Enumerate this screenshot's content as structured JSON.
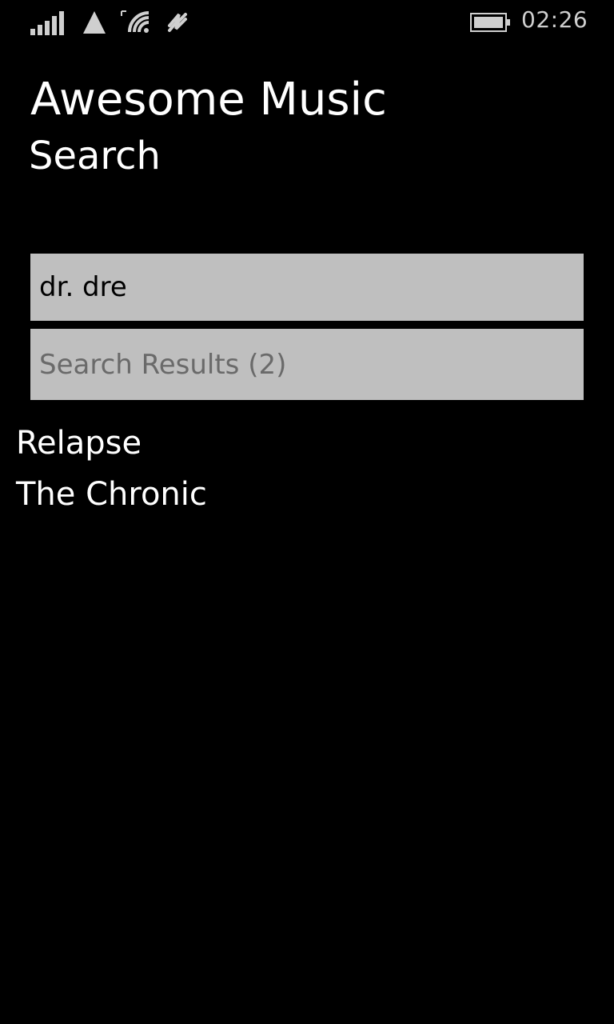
{
  "status_bar": {
    "time": "02:26",
    "icons": [
      "signal-icon",
      "triangle-icon",
      "wifi-icon",
      "data-sync-icon",
      "battery-icon"
    ]
  },
  "header": {
    "app_title": "Awesome Music",
    "page_title": "Search"
  },
  "search": {
    "value": "dr. dre",
    "results_label": "Search Results (2)"
  },
  "results": [
    {
      "title": "Relapse"
    },
    {
      "title": "The Chronic"
    }
  ],
  "colors": {
    "background": "#000000",
    "input_background": "#bfbfbf",
    "placeholder_text": "#6a6a6a",
    "foreground": "#ffffff"
  }
}
